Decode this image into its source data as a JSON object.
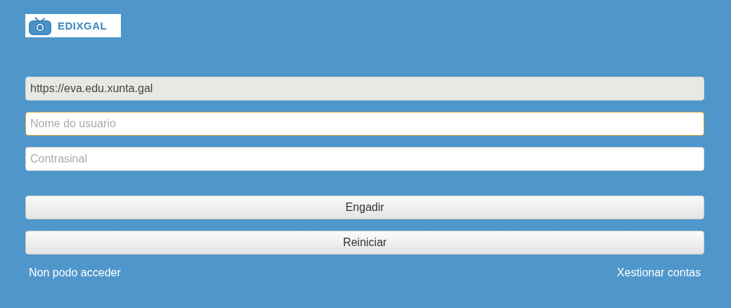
{
  "logo": {
    "text": "EDIXGAL"
  },
  "fields": [
    {
      "value": "https://eva.edu.xunta.gal",
      "disabled": true,
      "focused": false
    },
    {
      "placeholder": "Nome do usuario",
      "disabled": false,
      "focused": true
    },
    {
      "placeholder": "Contrasinal",
      "disabled": false,
      "focused": false
    }
  ],
  "buttons": [
    "Engadir",
    "Reiniciar"
  ],
  "links": [
    "Non podo acceder",
    "Xestionar contas"
  ]
}
